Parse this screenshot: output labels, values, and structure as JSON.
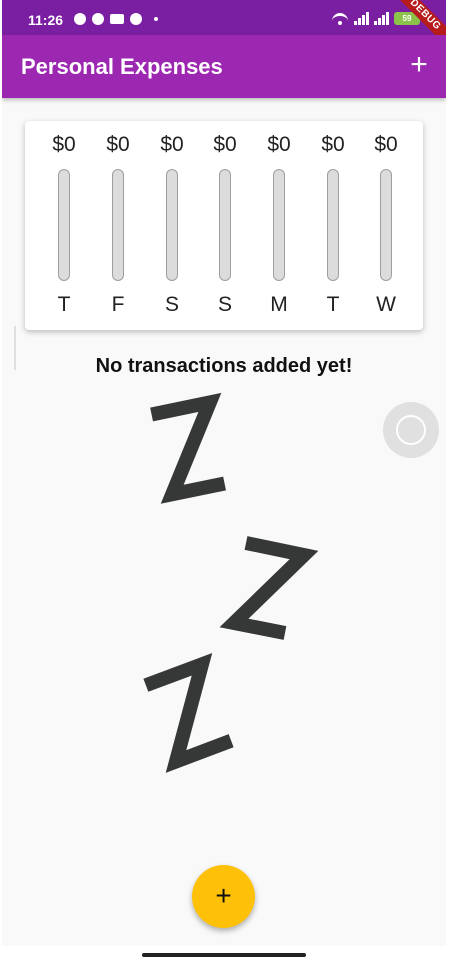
{
  "status_bar": {
    "time": "11:26",
    "battery": "59",
    "debug_label": "DEBUG",
    "icons": [
      "alarm-icon",
      "shield-icon",
      "video-icon",
      "sync-icon",
      "dot-icon",
      "wifi-icon",
      "signal-icon",
      "signal-icon",
      "battery-icon"
    ]
  },
  "app_bar": {
    "title": "Personal Expenses",
    "action_icon": "plus-icon",
    "action_label": "+"
  },
  "chart": {
    "days": [
      {
        "label": "T",
        "amount": "$0",
        "fraction": 0
      },
      {
        "label": "F",
        "amount": "$0",
        "fraction": 0
      },
      {
        "label": "S",
        "amount": "$0",
        "fraction": 0
      },
      {
        "label": "S",
        "amount": "$0",
        "fraction": 0
      },
      {
        "label": "M",
        "amount": "$0",
        "fraction": 0
      },
      {
        "label": "T",
        "amount": "$0",
        "fraction": 0
      },
      {
        "label": "W",
        "amount": "$0",
        "fraction": 0
      }
    ]
  },
  "empty_state": {
    "message": "No transactions added yet!",
    "illustration": "sleep-zzz"
  },
  "fab": {
    "icon": "plus-icon",
    "label": "+"
  },
  "colors": {
    "primary": "#9c27b0",
    "status_bar": "#7b1fa2",
    "accent": "#ffc107",
    "background": "#f8f9f8"
  }
}
